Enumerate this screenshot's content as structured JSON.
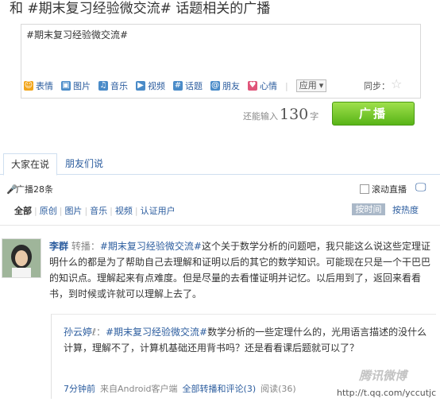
{
  "title": "和 #期末复习经验微交流# 话题相关的广播",
  "compose": {
    "text": "#期末复习经验微交流#",
    "tools": [
      {
        "name": "emoji-icon",
        "label": "表情",
        "color": "#f2a51a",
        "glyph": "☺"
      },
      {
        "name": "image-icon",
        "label": "图片",
        "color": "#4a8bc8",
        "glyph": "▣"
      },
      {
        "name": "music-icon",
        "label": "音乐",
        "color": "#4a8bc8",
        "glyph": "♫"
      },
      {
        "name": "video-icon",
        "label": "视频",
        "color": "#4a8bc8",
        "glyph": "▶"
      },
      {
        "name": "topic-icon",
        "label": "话题",
        "color": "#4a8bc8",
        "glyph": "#"
      },
      {
        "name": "friend-icon",
        "label": "朋友",
        "color": "#4a8bc8",
        "glyph": "@"
      },
      {
        "name": "mood-icon",
        "label": "心情",
        "color": "#e0557a",
        "glyph": "♥"
      }
    ],
    "app_label": "应用",
    "sync_label": "同步：",
    "count_prefix": "还能输入",
    "count_num": "130",
    "count_suffix": "字",
    "post_label": "广播"
  },
  "tabs": {
    "all": "大家在说",
    "friends": "朋友们说"
  },
  "stats": {
    "count": "广播28条",
    "scroll": "滚动直播"
  },
  "filters": [
    "全部",
    "原创",
    "图片",
    "音乐",
    "视频",
    "认证用户"
  ],
  "sort": {
    "time": "按时间",
    "hot": "按热度"
  },
  "post": {
    "author": "李群",
    "action": "转播：",
    "topic": "#期末复习经验微交流#",
    "text": "这个关于数学分析的问题吧，我只能这么说这些定理证明什么的都是为了帮助自己去理解和证明以后的其它的数学知识。可能现在只是一个干巴巴的知识点。理解起来有点难度。但是尽量的去看懂证明并记忆。以后用到了，返回来看看书，到时候或许就可以理解上去了。",
    "quote": {
      "author": "孙云婷",
      "topic": "#期末复习经验微交流#",
      "text": "数学分析的一些定理什么的，光用语言描述的没什么计算，理解不了，计算机基础还用背书吗？还是看看课后题就可以了？",
      "time": "7分钟前",
      "source": "来自Android客户端",
      "retweets": "全部转播和评论(3)",
      "reads": "阅读(36)"
    }
  },
  "watermark": {
    "logo": "腾讯微博",
    "url": "http://t.qq.com/yccutjc"
  }
}
